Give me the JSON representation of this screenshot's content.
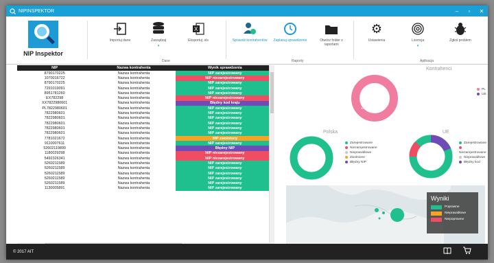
{
  "window": {
    "title": "NIPINSPEKTOR",
    "controls": [
      "–",
      "▫",
      "✕"
    ]
  },
  "logo": {
    "name": "NIP Inspektor"
  },
  "ribbon": {
    "buttons": [
      {
        "id": "import",
        "label": "Importuj dane",
        "icon": "import-icon"
      },
      {
        "id": "manage",
        "label": "Zarządzaj",
        "icon": "database-icon"
      },
      {
        "id": "export",
        "label": "Eksportuj .xls",
        "icon": "excel-icon"
      },
      {
        "id": "check",
        "label": "Sprawdź kontrahentów",
        "icon": "user-check-icon"
      },
      {
        "id": "schedule",
        "label": "Zaplanuj sprawdzenie",
        "icon": "clock-icon"
      },
      {
        "id": "folder",
        "label": "Otwórz folder z raportami",
        "icon": "folder-icon"
      },
      {
        "id": "settings",
        "label": "Ustawienia",
        "icon": "gear-icon"
      },
      {
        "id": "license",
        "label": "Licencja",
        "icon": "fingerprint-icon"
      },
      {
        "id": "report",
        "label": "Zgłoś problem",
        "icon": "bug-icon"
      }
    ],
    "groups": {
      "data": "Dane",
      "reports": "Raporty",
      "app": "Aplikacja"
    }
  },
  "table": {
    "headers": [
      "NIP",
      "Nazwa kontrahenta",
      "Wynik sprawdzenia"
    ],
    "rows": [
      [
        "8790170225",
        "Nazwa kontrahenta",
        "NIP zarejestrowany",
        "green"
      ],
      [
        "1070016722",
        "Nazwa kontrahenta",
        "NIP niezarejestrowany",
        "red"
      ],
      [
        "8790170225",
        "Nazwa kontrahenta",
        "NIP zarejestrowany",
        "green"
      ],
      [
        "7291019091",
        "Nazwa kontrahenta",
        "NIP zarejestrowany",
        "green"
      ],
      [
        "8951781260",
        "Nazwa kontrahenta",
        "NIP zarejestrowany",
        "green"
      ],
      [
        "EX782298",
        "Nazwa kontrahenta",
        "NIP niezarejestrowany",
        "red"
      ],
      [
        "XX7822980601",
        "Nazwa kontrahenta",
        "Błędny kod kraju",
        "purple"
      ],
      [
        "PL7822980601",
        "Nazwa kontrahenta",
        "NIP zarejestrowany",
        "green"
      ],
      [
        "7822980601",
        "Nazwa kontrahenta",
        "NIP zarejestrowany",
        "green"
      ],
      [
        "7822980601",
        "Nazwa kontrahenta",
        "NIP zarejestrowany",
        "green"
      ],
      [
        "7822980601",
        "Nazwa kontrahenta",
        "NIP zarejestrowany",
        "green"
      ],
      [
        "7822980601",
        "Nazwa kontrahenta",
        "NIP zarejestrowany",
        "green"
      ],
      [
        "7822980601",
        "Nazwa kontrahenta",
        "NIP zarejestrowany",
        "green"
      ],
      [
        "7781021672",
        "Nazwa kontrahenta",
        "NIP zwolniony",
        "orange"
      ],
      [
        "9110007611",
        "Nazwa kontrahenta",
        "NIP zarejestrowany",
        "green"
      ],
      [
        "52602119890",
        "Nazwa kontrahenta",
        "Błędny NIP",
        "purple"
      ],
      [
        "1180029298",
        "Nazwa kontrahenta",
        "NIP niezarejestrowany",
        "red"
      ],
      [
        "5492326341",
        "Nazwa kontrahenta",
        "NIP niezarejestrowany",
        "red"
      ],
      [
        "5260211589",
        "Nazwa kontrahenta",
        "NIP zarejestrowany",
        "green"
      ],
      [
        "5260211589",
        "Nazwa kontrahenta",
        "NIP zarejestrowany",
        "green"
      ],
      [
        "5260211589",
        "Nazwa kontrahenta",
        "NIP zarejestrowany",
        "green"
      ],
      [
        "5260211589",
        "Nazwa kontrahenta",
        "NIP zarejestrowany",
        "green"
      ],
      [
        "5260211589",
        "Nazwa kontrahenta",
        "NIP zarejestrowany",
        "green"
      ],
      [
        "1130005891",
        "Nazwa kontrahenta",
        "NIP zarejestrowany",
        "green"
      ]
    ],
    "colors": {
      "green": "#1fc08e",
      "red": "#ee4d62",
      "purple": "#6f4bb8",
      "orange": "#f7a325"
    }
  },
  "charts": {
    "kontrahenci": {
      "title": "Kontrahenci",
      "legend": [
        "PL",
        "UE"
      ],
      "colors": [
        "#f07ca0",
        "#6f4bb8"
      ],
      "center_label": "90%"
    },
    "polska": {
      "title": "Polska",
      "legend": [
        "Zarejestrowane",
        "Niezarejestrowane",
        "Nieprawidłowe",
        "Zwolnione",
        "Błędny NIP"
      ],
      "colors": [
        "#1fc08e",
        "#ee4d62",
        "#c8c8c8",
        "#f7a325",
        "#6f4bb8"
      ]
    },
    "ue": {
      "title": "UE",
      "legend": [
        "Zarejestrowane",
        "Niezarejestrowane",
        "Nieprawidłowe",
        "Błędny kod"
      ],
      "colors": [
        "#1fc08e",
        "#ee4d62",
        "#c8c8c8",
        "#6f4bb8"
      ]
    }
  },
  "wyniki": {
    "title": "Wyniki",
    "items": [
      {
        "label": "Poprawne",
        "color": "#1fc08e"
      },
      {
        "label": "Nieprawidłowe",
        "color": "#f7a325"
      },
      {
        "label": "Niepoprawne",
        "color": "#ee4d62"
      }
    ]
  },
  "status": {
    "copyright": "© 2017 AIT"
  }
}
